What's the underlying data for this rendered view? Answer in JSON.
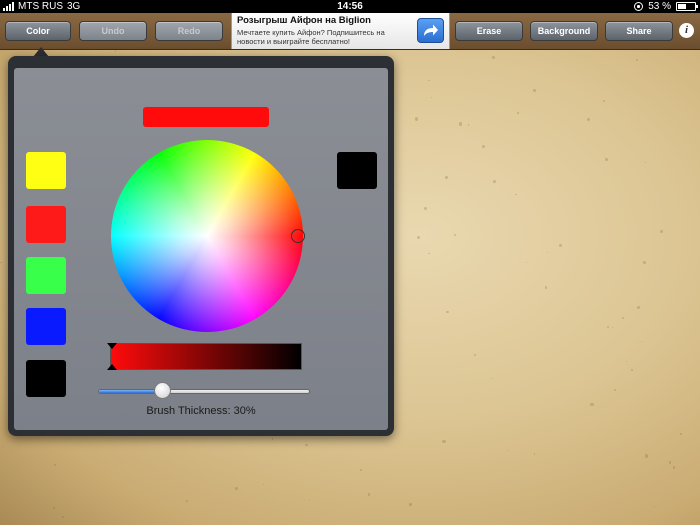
{
  "status_bar": {
    "carrier": "MTS RUS",
    "network": "3G",
    "time": "14:56",
    "battery_percent": "53 %",
    "battery_level": 0.53
  },
  "toolbar": {
    "color_label": "Color",
    "undo_label": "Undo",
    "redo_label": "Redo",
    "erase_label": "Erase",
    "background_label": "Background",
    "share_label": "Share",
    "info_label": "i"
  },
  "ad": {
    "title": "Розыгрыш Айфон на Biglion",
    "text": "Мечтаете купить Айфон? Подпишитесь на новости и выиграйте бесплатно!",
    "action_icon": "share-arrow-icon"
  },
  "color_picker": {
    "selected_color": "#ff0b0b",
    "current_swatch_color": "#000000",
    "presets": [
      {
        "name": "yellow",
        "color": "#ffff14"
      },
      {
        "name": "red",
        "color": "#ff1a1a"
      },
      {
        "name": "green",
        "color": "#38ff4a"
      },
      {
        "name": "blue",
        "color": "#0a1aff"
      },
      {
        "name": "black",
        "color": "#000000"
      }
    ],
    "brush_thickness_label": "Brush Thickness: 30%",
    "brush_thickness": 0.3
  },
  "colors": {
    "toolbar_bg": "#7a5a38",
    "popover_frame": "#2c2f34",
    "popover_bg": "#838790",
    "accent_blue": "#2f6fd3"
  }
}
